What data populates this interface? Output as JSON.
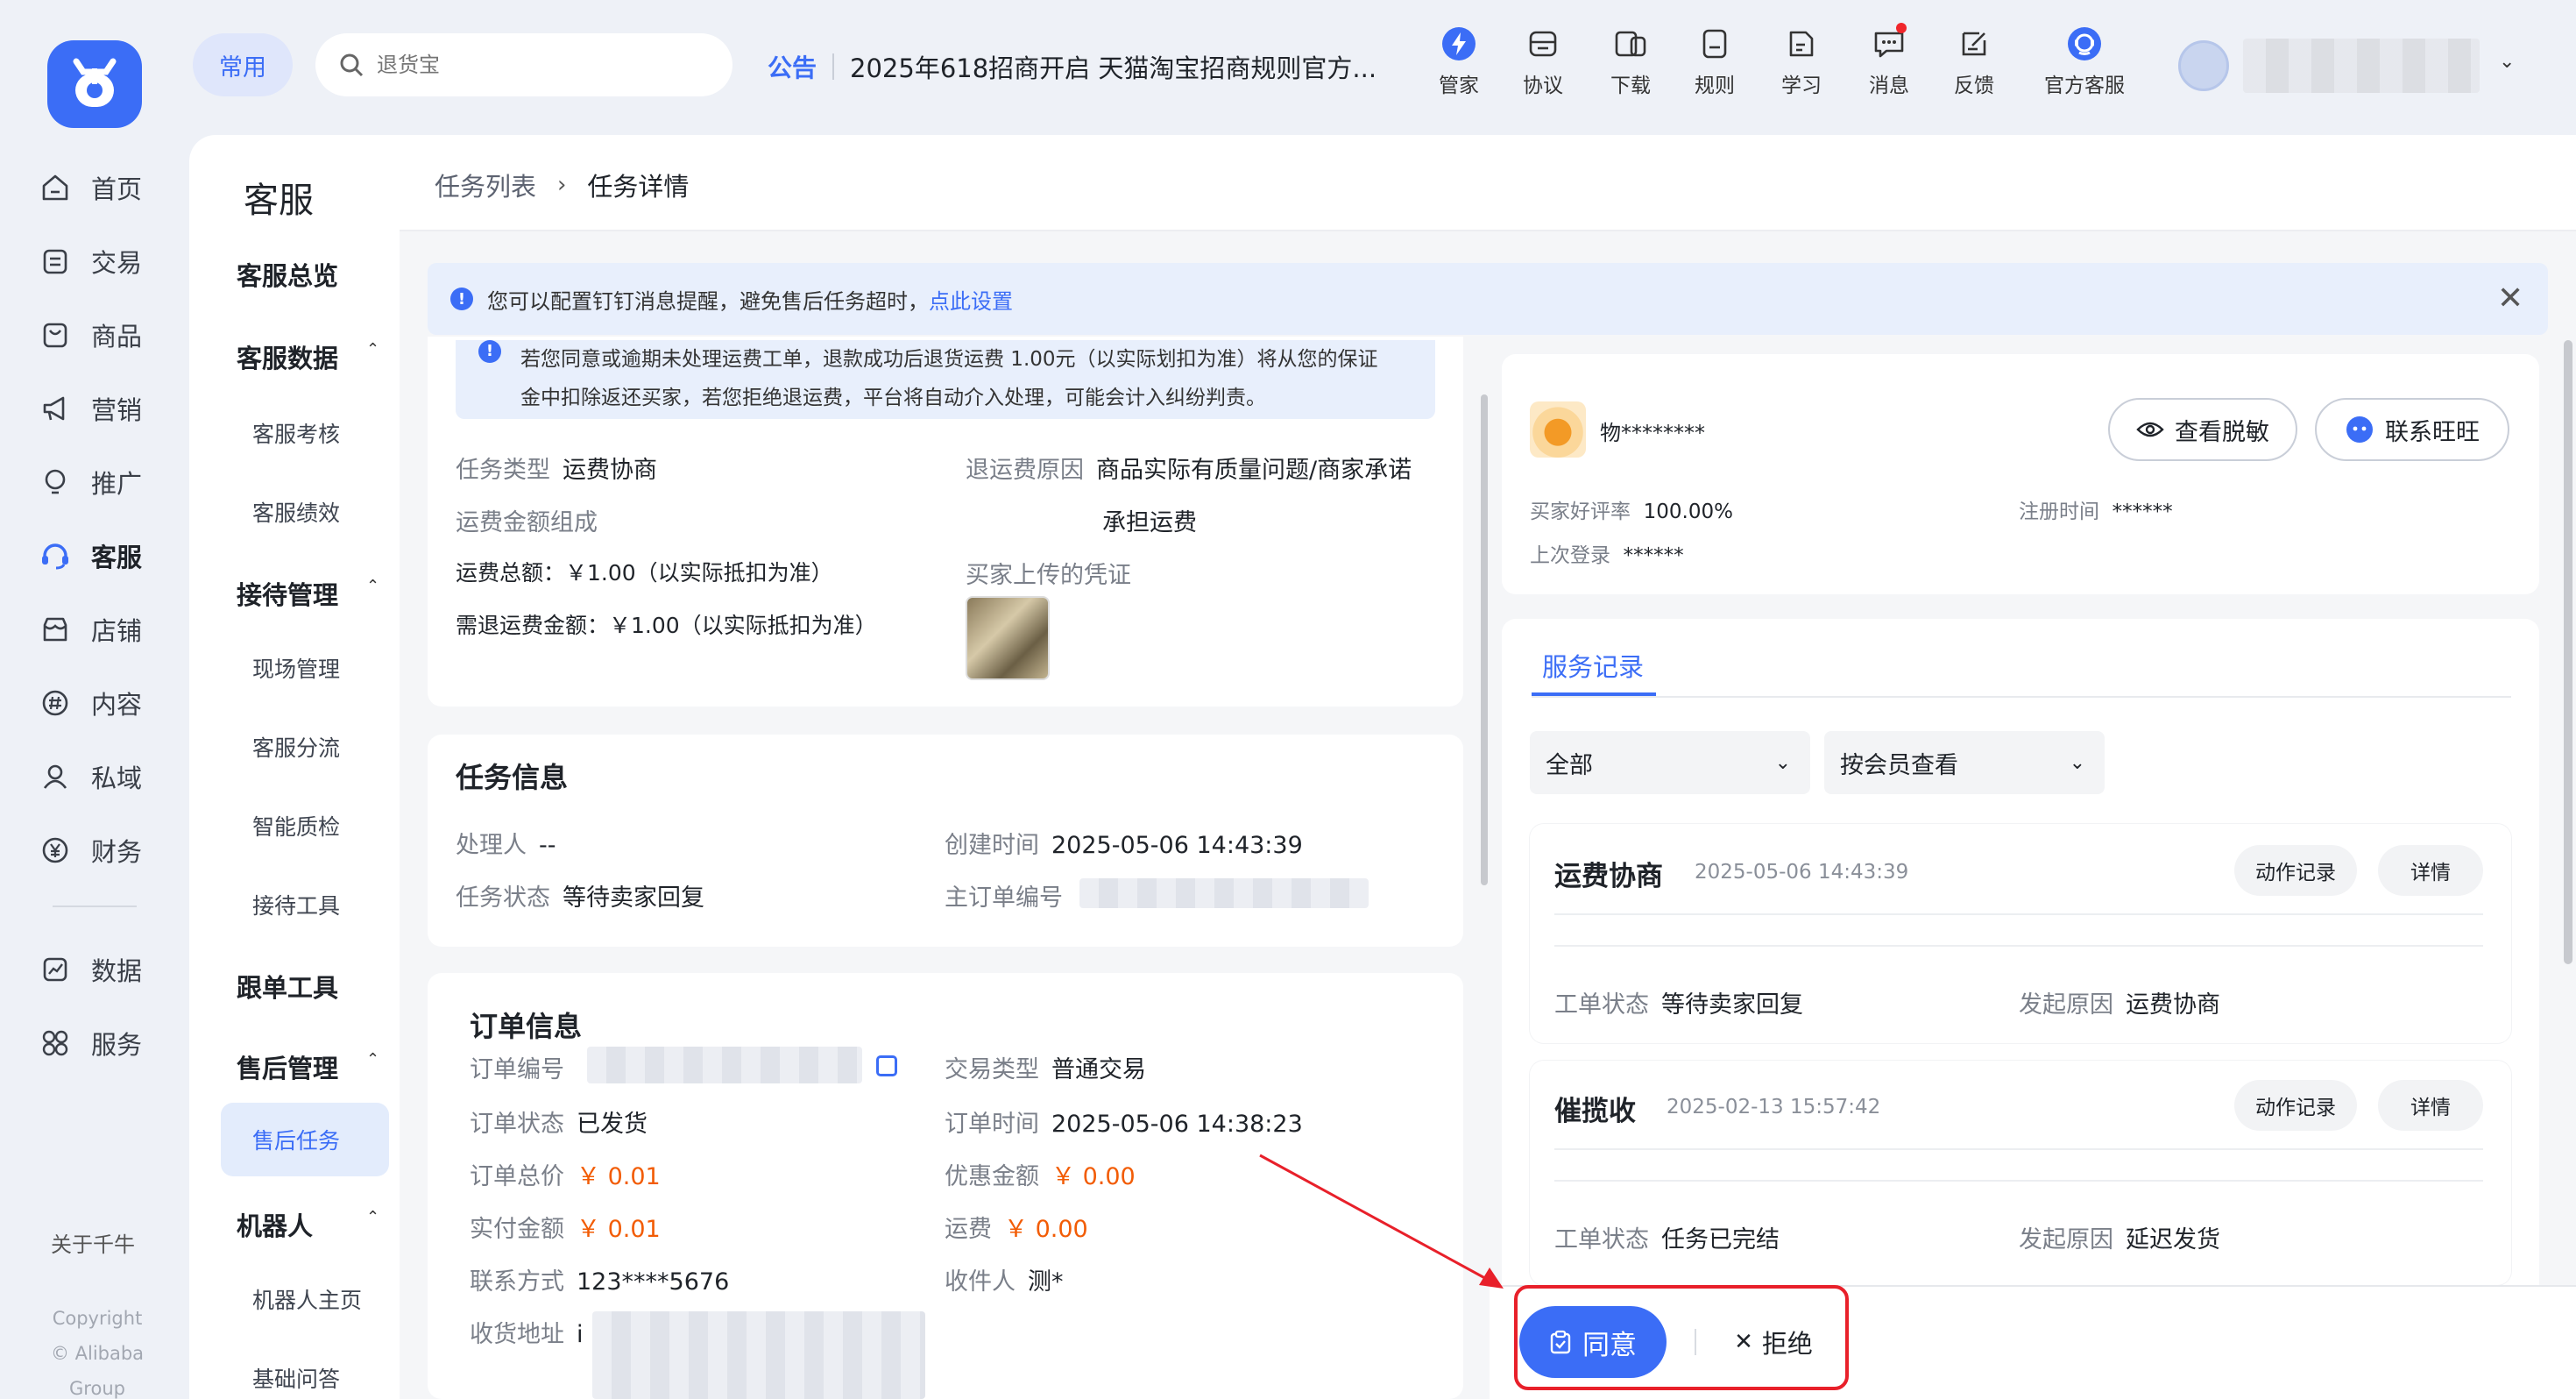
{
  "topbar": {
    "common_label": "常用",
    "search_placeholder": "退货宝",
    "notice_tag": "公告",
    "notice_text": "2025年618招商开启 天猫淘宝招商规则官方...",
    "icons": [
      {
        "label": "管家",
        "icon": "bolt-icon"
      },
      {
        "label": "协议",
        "icon": "agreement-icon"
      },
      {
        "label": "下载",
        "icon": "download-icon"
      },
      {
        "label": "规则",
        "icon": "rules-icon"
      },
      {
        "label": "学习",
        "icon": "learn-icon"
      },
      {
        "label": "消息",
        "icon": "message-icon"
      },
      {
        "label": "反馈",
        "icon": "feedback-icon"
      },
      {
        "label": "官方客服",
        "icon": "service-icon"
      }
    ]
  },
  "leftnav": {
    "items": [
      "首页",
      "交易",
      "商品",
      "营销",
      "推广",
      "客服",
      "店铺",
      "内容",
      "私域",
      "财务",
      "数据",
      "服务"
    ],
    "active": "客服",
    "about": "关于千牛",
    "copyright": "Copyright",
    "company": "© Alibaba Group"
  },
  "subnav": {
    "title": "客服",
    "overview": "客服总览",
    "data_h": "客服数据",
    "data_items": [
      "客服考核",
      "客服绩效"
    ],
    "reception_h": "接待管理",
    "reception_items": [
      "现场管理",
      "客服分流",
      "智能质检",
      "接待工具"
    ],
    "follow_h": "跟单工具",
    "aftersale_h": "售后管理",
    "aftersale_active": "售后任务",
    "robot_h": "机器人",
    "robot_items": [
      "机器人主页",
      "基础问答"
    ]
  },
  "breadcrumb": {
    "parent": "任务列表",
    "sep": "›",
    "current": "任务详情"
  },
  "alert": {
    "text": "您可以配置钉钉消息提醒，避免售后任务超时，",
    "link": "点此设置"
  },
  "freight": {
    "warning_1": "若您同意或逾期未处理运费工单，退款成功后退货运费 1.00元（以实际划扣为准）将从您的保证",
    "warning_2": "金中扣除返还买家，若您拒绝退运费，平台将自动介入处理，可能会计入纠纷判责。",
    "task_type_label": "任务类型",
    "task_type": "运费协商",
    "reason_label": "退运费原因",
    "reason_1": "商品实际有质量问题/商家承诺",
    "reason_2": "承担运费",
    "composition_label": "运费金额组成",
    "total": "运费总额：￥1.00（以实际抵扣为准）",
    "refund": "需退运费金额：￥1.00（以实际抵扣为准）",
    "evidence_label": "买家上传的凭证"
  },
  "task_info": {
    "title": "任务信息",
    "handler_label": "处理人",
    "handler": "--",
    "created_label": "创建时间",
    "created": "2025-05-06 14:43:39",
    "status_label": "任务状态",
    "status": "等待卖家回复",
    "main_order_label": "主订单编号"
  },
  "order_info": {
    "title": "订单信息",
    "order_no_label": "订单编号",
    "trade_type_label": "交易类型",
    "trade_type": "普通交易",
    "order_status_label": "订单状态",
    "order_status": "已发货",
    "order_time_label": "订单时间",
    "order_time": "2025-05-06 14:38:23",
    "total_label": "订单总价",
    "total": "￥ 0.01",
    "discount_label": "优惠金额",
    "discount": "￥ 0.00",
    "paid_label": "实付金额",
    "paid": "￥ 0.01",
    "shipping_label": "运费",
    "shipping": "￥ 0.00",
    "contact_label": "联系方式",
    "contact": "123****5676",
    "receiver_label": "收件人",
    "receiver": "测*",
    "address_label": "收货地址",
    "address_prefix": "i"
  },
  "buyer": {
    "name": "物********",
    "view_btn": "查看脱敏",
    "contact_btn": "联系旺旺",
    "rating_label": "买家好评率",
    "rating": "100.00%",
    "reg_label": "注册时间",
    "reg": "******",
    "last_label": "上次登录",
    "last": "******"
  },
  "records": {
    "tab": "服务记录",
    "filter1": "全部",
    "filter2": "按会员查看",
    "items": [
      {
        "title": "运费协商",
        "time": "2025-05-06 14:43:39",
        "action": "动作记录",
        "detail": "详情",
        "status_label": "工单状态",
        "status": "等待卖家回复",
        "reason_label": "发起原因",
        "reason": "运费协商"
      },
      {
        "title": "催揽收",
        "time": "2025-02-13 15:57:42",
        "action": "动作记录",
        "detail": "详情",
        "status_label": "工单状态",
        "status": "任务已完结",
        "reason_label": "发起原因",
        "reason": "延迟发货"
      }
    ]
  },
  "actions": {
    "agree": "同意",
    "reject": "拒绝"
  },
  "colors": {
    "accent": "#3b6df6",
    "price": "#f25c05",
    "highlight": "#e8202a"
  }
}
